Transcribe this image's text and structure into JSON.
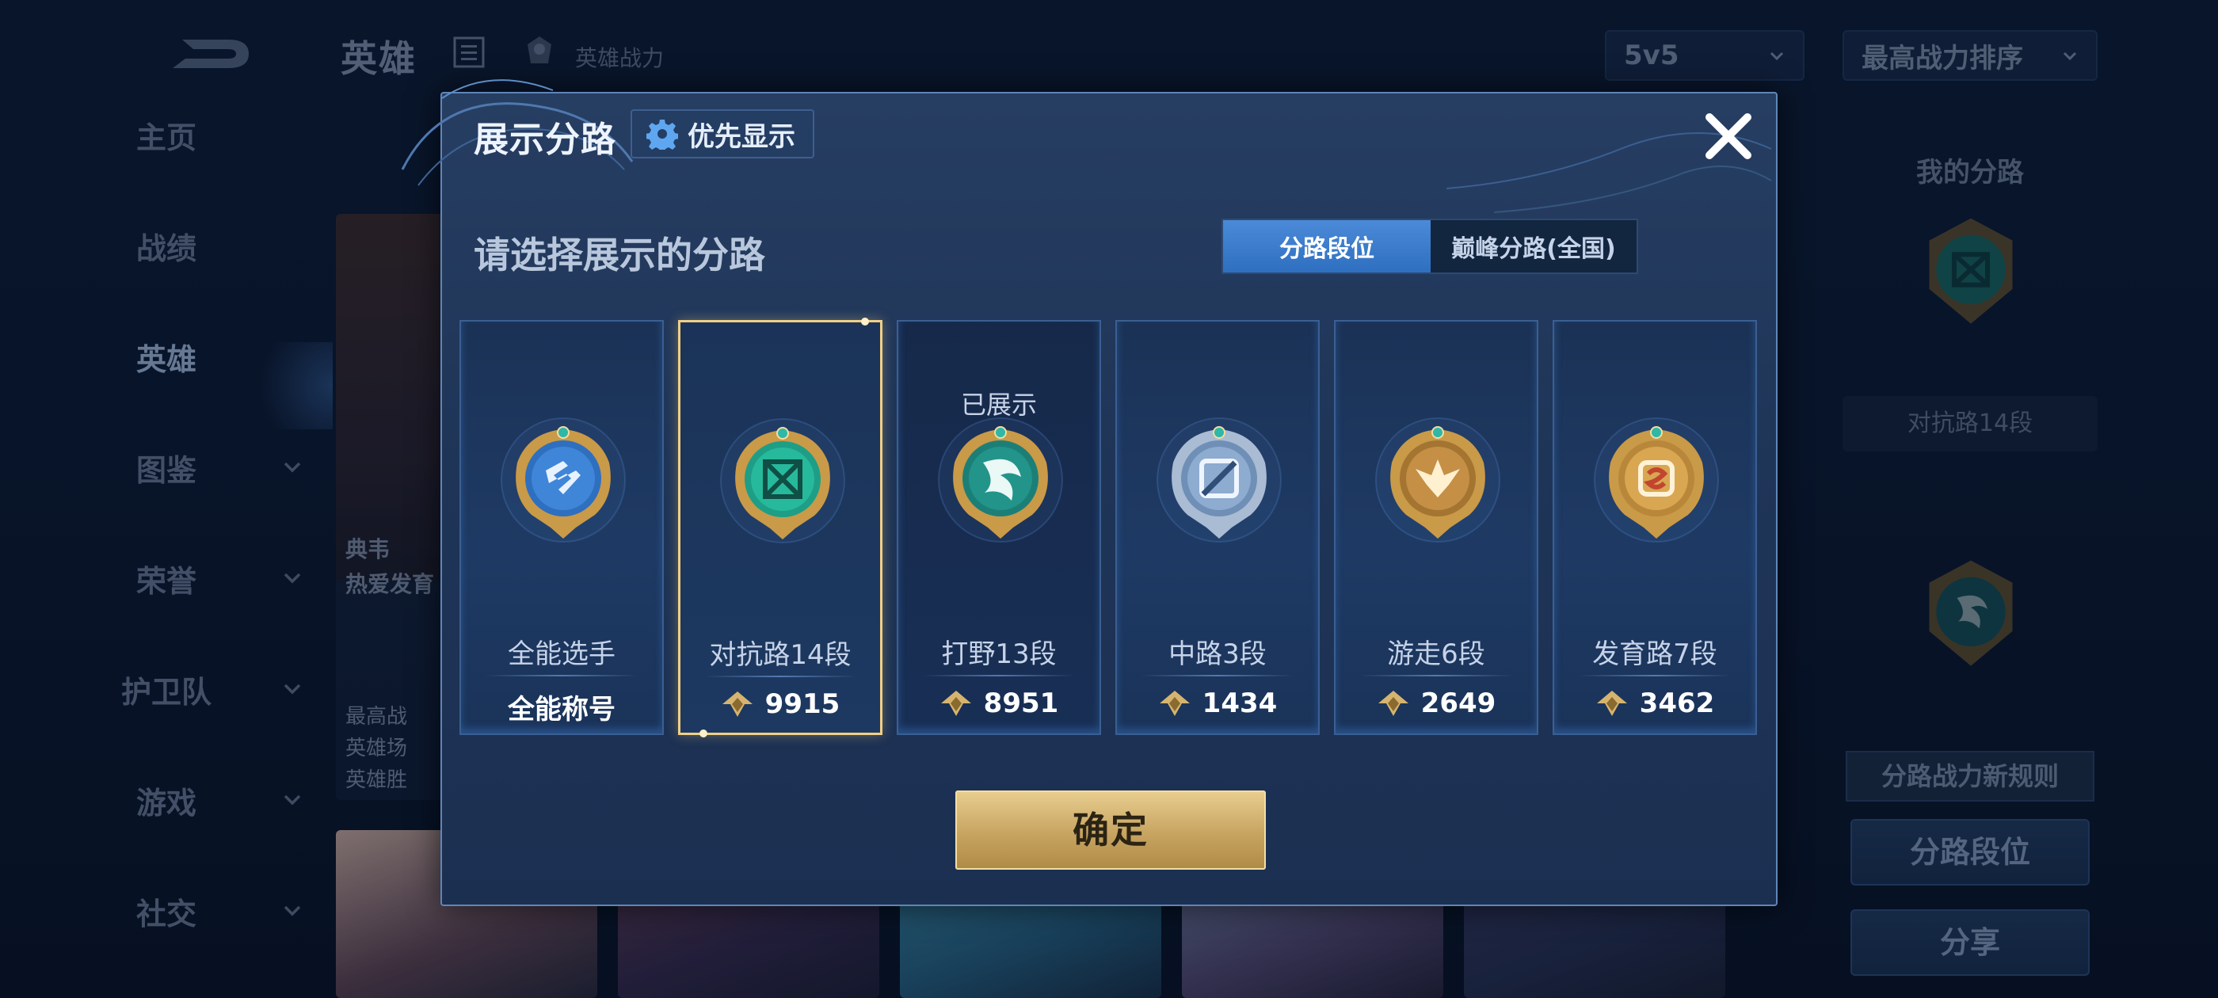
{
  "background": {
    "header": {
      "title": "英雄",
      "power_label": "英雄战力"
    },
    "mode_select": "5v5",
    "sort_select": "最高战力排序",
    "nav": [
      {
        "label": "主页",
        "has_chevron": false,
        "active": false
      },
      {
        "label": "战绩",
        "has_chevron": false,
        "active": false
      },
      {
        "label": "英雄",
        "has_chevron": false,
        "active": true
      },
      {
        "label": "图鉴",
        "has_chevron": true,
        "active": false
      },
      {
        "label": "荣誉",
        "has_chevron": true,
        "active": false
      },
      {
        "label": "护卫队",
        "has_chevron": true,
        "active": false
      },
      {
        "label": "游戏",
        "has_chevron": true,
        "active": false
      },
      {
        "label": "社交",
        "has_chevron": true,
        "active": false
      }
    ],
    "hero_card": {
      "line1": "典韦",
      "line2": "热爱发育",
      "stat1": "最高战",
      "stat2": "英雄场",
      "stat3": "英雄胜"
    },
    "right_panel": {
      "title": "我的分路",
      "lane_label": "对抗路14段",
      "rule_label": "分路战力新规则",
      "rank_button": "分路段位",
      "share_button": "分享"
    }
  },
  "modal": {
    "title": "展示分路",
    "priority_button": "优先显示",
    "subtitle": "请选择展示的分路",
    "tabs": {
      "active": "分路段位",
      "inactive": "巅峰分路(全国)"
    },
    "cards": [
      {
        "lane": "全能选手",
        "value": "全能称号",
        "is_title": true,
        "selected": false,
        "shown": false,
        "badge": "all-rounder-badge-icon"
      },
      {
        "lane": "对抗路14段",
        "value": "9915",
        "is_title": false,
        "selected": true,
        "shown": false,
        "badge": "clash-lane-badge-icon"
      },
      {
        "lane": "打野13段",
        "value": "8951",
        "is_title": false,
        "selected": false,
        "shown": true,
        "shown_label": "已展示",
        "badge": "jungle-badge-icon"
      },
      {
        "lane": "中路3段",
        "value": "1434",
        "is_title": false,
        "selected": false,
        "shown": false,
        "badge": "mid-lane-badge-icon"
      },
      {
        "lane": "游走6段",
        "value": "2649",
        "is_title": false,
        "selected": false,
        "shown": false,
        "badge": "roam-badge-icon"
      },
      {
        "lane": "发育路7段",
        "value": "3462",
        "is_title": false,
        "selected": false,
        "shown": false,
        "badge": "farm-lane-badge-icon"
      }
    ],
    "confirm_button": "确定"
  },
  "colors": {
    "accent_blue": "#3f7fd0",
    "gold": "#d6b46f",
    "selected_border": "#f0cf86"
  }
}
